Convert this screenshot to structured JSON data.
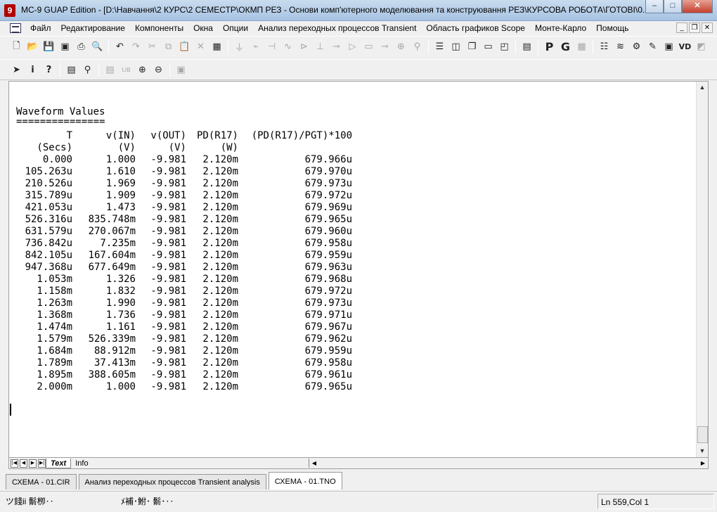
{
  "window": {
    "app_icon_glyph": "9",
    "title": "MC-9 GUAP Edition - [D:\\Навчання\\2 КУРС\\2 СЕМЕСТР\\ОКМП РЕЗ - Основи комп'ютерного моделювання та конструювання РЕЗ\\КУРСОВА РОБОТА\\ГОТОВІ\\0...",
    "buttons": {
      "minimize": "–",
      "maximize": "□",
      "close": "✕"
    }
  },
  "menu": {
    "items": [
      "Файл",
      "Редактирование",
      "Компоненты",
      "Окна",
      "Опции",
      "Анализ переходных процессов Transient",
      "Область графиков Scope",
      "Монте-Карло",
      "Помощь"
    ],
    "mdi_buttons": {
      "minimize": "_",
      "restore": "❐",
      "close": "✕"
    }
  },
  "toolbar1": {
    "icons": [
      "new-file-icon",
      "open-folder-icon",
      "save-icon",
      "save-all-icon",
      "print-icon",
      "print-preview-icon",
      "undo-icon",
      "redo-icon",
      "cut-icon",
      "copy-icon",
      "paste-icon",
      "delete-icon",
      "select-all-icon",
      "ground-icon",
      "resistor-icon",
      "capacitor-icon",
      "inductor-icon",
      "diode-icon",
      "battery-icon",
      "transistor-icon",
      "opamp-icon",
      "macro-icon",
      "wire-icon",
      "node-icon",
      "probe-icon",
      "horizontal-tile-icon",
      "vertical-tile-icon",
      "cascade-icon",
      "window-icon",
      "split-window-icon",
      "calculator-icon",
      "p-icon",
      "g-icon",
      "grid-icon",
      "component-list-icon",
      "waveform-icon",
      "analysis-icon",
      "pen-icon",
      "scope-icon",
      "vi-icon",
      "properties-icon"
    ]
  },
  "toolbar2": {
    "icons": [
      "select-arrow-icon",
      "info-icon",
      "help-query-icon",
      "properties-icon",
      "find-icon",
      "text-mode-icon",
      "library-icon",
      "zoom-in-icon",
      "zoom-out-icon",
      "camera-icon"
    ]
  },
  "output": {
    "title": "Waveform Values",
    "underline": "===============",
    "headers": [
      "T",
      "v(IN)",
      "v(OUT)",
      "PD(R17)",
      "(PD(R17)/PGT)*100"
    ],
    "units": [
      "(Secs)",
      "(V)",
      "(V)",
      "(W)",
      ""
    ],
    "rows": [
      [
        "0.000",
        "1.000",
        "-9.981",
        "2.120m",
        "679.966u"
      ],
      [
        "105.263u",
        "1.610",
        "-9.981",
        "2.120m",
        "679.970u"
      ],
      [
        "210.526u",
        "1.969",
        "-9.981",
        "2.120m",
        "679.973u"
      ],
      [
        "315.789u",
        "1.909",
        "-9.981",
        "2.120m",
        "679.972u"
      ],
      [
        "421.053u",
        "1.473",
        "-9.981",
        "2.120m",
        "679.969u"
      ],
      [
        "526.316u",
        "835.748m",
        "-9.981",
        "2.120m",
        "679.965u"
      ],
      [
        "631.579u",
        "270.067m",
        "-9.981",
        "2.120m",
        "679.960u"
      ],
      [
        "736.842u",
        "7.235m",
        "-9.981",
        "2.120m",
        "679.958u"
      ],
      [
        "842.105u",
        "167.604m",
        "-9.981",
        "2.120m",
        "679.959u"
      ],
      [
        "947.368u",
        "677.649m",
        "-9.981",
        "2.120m",
        "679.963u"
      ],
      [
        "1.053m",
        "1.326",
        "-9.981",
        "2.120m",
        "679.968u"
      ],
      [
        "1.158m",
        "1.832",
        "-9.981",
        "2.120m",
        "679.972u"
      ],
      [
        "1.263m",
        "1.990",
        "-9.981",
        "2.120m",
        "679.973u"
      ],
      [
        "1.368m",
        "1.736",
        "-9.981",
        "2.120m",
        "679.971u"
      ],
      [
        "1.474m",
        "1.161",
        "-9.981",
        "2.120m",
        "679.967u"
      ],
      [
        "1.579m",
        "526.339m",
        "-9.981",
        "2.120m",
        "679.962u"
      ],
      [
        "1.684m",
        "88.912m",
        "-9.981",
        "2.120m",
        "679.959u"
      ],
      [
        "1.789m",
        "37.413m",
        "-9.981",
        "2.120m",
        "679.958u"
      ],
      [
        "1.895m",
        "388.605m",
        "-9.981",
        "2.120m",
        "679.961u"
      ],
      [
        "2.000m",
        "1.000",
        "-9.981",
        "2.120m",
        "679.965u"
      ]
    ]
  },
  "sheet_tabs": {
    "active": "Text",
    "other": "Info"
  },
  "doc_tabs": [
    "СХЕМА - 01.CIR",
    "Анализ переходных процессов Transient analysis",
    "СХЕМА - 01.TNO"
  ],
  "status": {
    "left": "ツ錢ii 鬋栁‥",
    "middle": "ﾒ補･鮒･ 鬋･‥",
    "position": "Ln 559,Col 1"
  }
}
